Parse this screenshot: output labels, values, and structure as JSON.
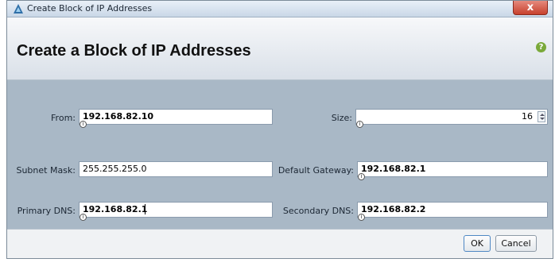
{
  "window": {
    "title": "Create Block of IP Addresses",
    "close_symbol": "x"
  },
  "header": {
    "title": "Create a Block of IP Addresses",
    "help_symbol": "?"
  },
  "form": {
    "from": {
      "label": "From:",
      "value": "192.168.82.10"
    },
    "size": {
      "label": "Size:",
      "value": "16"
    },
    "subnet_mask": {
      "label": "Subnet Mask:",
      "value": "255.255.255.0"
    },
    "default_gateway": {
      "label": "Default Gateway:",
      "value": "192.168.82.1"
    },
    "primary_dns": {
      "label": "Primary DNS:",
      "value": "192.168.82.1"
    },
    "secondary_dns": {
      "label": "Secondary DNS:",
      "value": "192.168.82.2"
    },
    "info_marker": "i"
  },
  "footer": {
    "ok_label": "OK",
    "cancel_label": "Cancel"
  }
}
